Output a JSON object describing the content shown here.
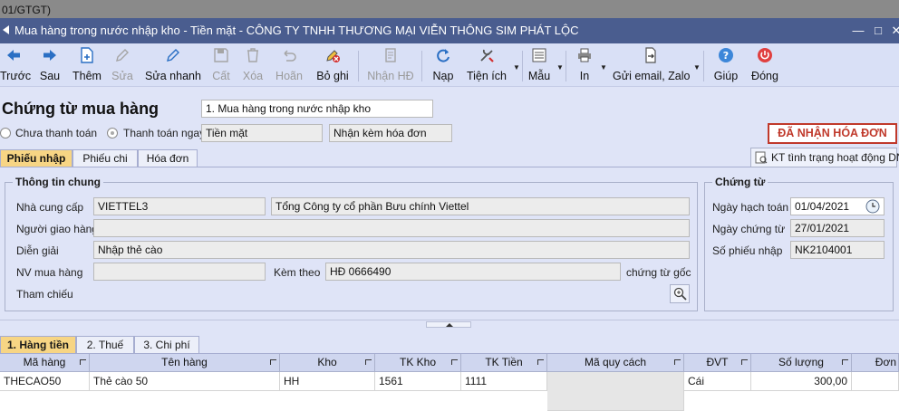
{
  "top_strip": "01/GTGT)",
  "window": {
    "title": "Mua hàng trong nước nhập kho - Tiền mặt - CÔNG TY TNHH THƯƠNG MẠI VIỄN THÔNG SIM PHÁT LỘC"
  },
  "toolbar": {
    "prev": "Trước",
    "next": "Sau",
    "add": "Thêm",
    "edit": "Sửa",
    "quick_edit": "Sửa nhanh",
    "save": "Cất",
    "delete": "Xóa",
    "undo": "Hoãn",
    "unpost": "Bỏ ghi",
    "receive_invoice": "Nhận HĐ",
    "reload": "Nạp",
    "utilities": "Tiện ích",
    "template": "Mẫu",
    "print": "In",
    "email_zalo": "Gửi email, Zalo",
    "help": "Giúp",
    "close": "Đóng"
  },
  "header": {
    "doc_title": "Chứng từ mua hàng",
    "doc_type": "1. Mua hàng trong nước nhập kho",
    "radio_unpaid": "Chưa thanh toán",
    "radio_paid": "Thanh toán ngay",
    "payment_method": "Tiền mặt",
    "invoice_option": "Nhận kèm hóa đơn",
    "received_badge": "ĐÃ NHẬN HÓA ĐƠN",
    "kt_button": "KT tình trạng hoạt động DN"
  },
  "tabs": [
    "Phiếu nhập",
    "Phiếu chi",
    "Hóa đơn"
  ],
  "general": {
    "section_title": "Thông tin chung",
    "supplier_label": "Nhà cung cấp",
    "supplier_code": "VIETTEL3",
    "supplier_name": "Tổng Công ty cổ phần Bưu chính Viettel",
    "deliverer_label": "Người giao hàng",
    "description_label": "Diễn giải",
    "description": "Nhập thẻ cào",
    "buyer_label": "NV mua hàng",
    "attach_label": "Kèm theo",
    "attach_value": "HĐ 0666490",
    "attach_suffix": "chứng từ gốc",
    "reference_label": "Tham chiếu"
  },
  "voucher": {
    "section_title": "Chứng từ",
    "posting_date_label": "Ngày hạch toán",
    "posting_date": "01/04/2021",
    "voucher_date_label": "Ngày chứng từ",
    "voucher_date": "27/01/2021",
    "voucher_no_label": "Số phiếu nhập",
    "voucher_no": "NK2104001"
  },
  "detail_tabs": [
    "1. Hàng tiền",
    "2. Thuế",
    "3. Chi phí"
  ],
  "grid": {
    "columns": [
      "Mã hàng",
      "Tên hàng",
      "Kho",
      "TK Kho",
      "TK Tiền",
      "Mã quy cách",
      "ĐVT",
      "Số lượng",
      "Đơn"
    ],
    "rows": [
      [
        "THECAO50",
        "Thẻ cào 50",
        "HH",
        "1561",
        "1111",
        "",
        "Cái",
        "300,00",
        ""
      ]
    ]
  },
  "colors": {
    "title_bar": "#4a5d8f",
    "badge_red": "#c0392b",
    "active_tab": "#f7d584",
    "toolbar_blue": "#2a6fc4"
  }
}
